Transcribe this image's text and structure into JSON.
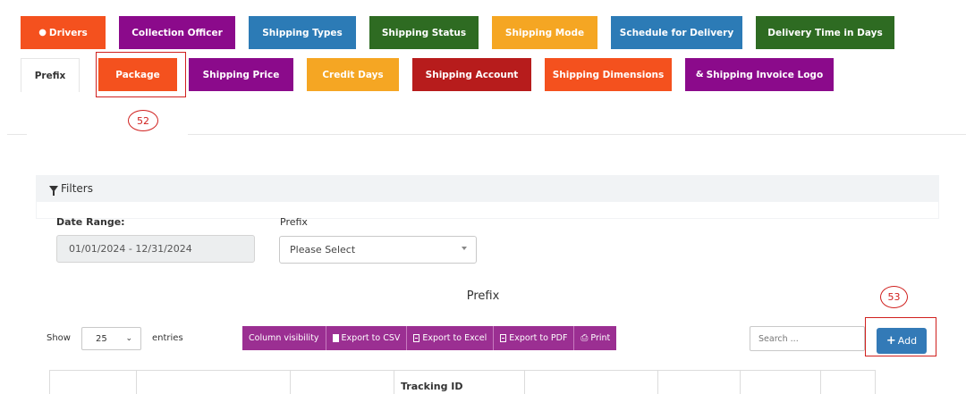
{
  "tabs_row1": [
    {
      "label": "Drivers",
      "color": "#f4511e",
      "icon": "user-icon"
    },
    {
      "label": "Collection Officer",
      "color": "#8b0a8b"
    },
    {
      "label": "Shipping Types",
      "color": "#2c7bb6"
    },
    {
      "label": "Shipping Status",
      "color": "#2e6b22"
    },
    {
      "label": "Shipping Mode",
      "color": "#f5a623"
    },
    {
      "label": "Schedule for Delivery",
      "color": "#2c7bb6"
    },
    {
      "label": "Delivery Time in Days",
      "color": "#2e6b22"
    }
  ],
  "tabs_row2": [
    {
      "label": "Prefix",
      "active": true
    },
    {
      "label": "Package",
      "color": "#f4511e"
    },
    {
      "label": "Shipping Price",
      "color": "#8b0a8b"
    },
    {
      "label": "Credit Days",
      "color": "#f5a623"
    },
    {
      "label": "Shipping Account",
      "color": "#b71c1c"
    },
    {
      "label": "Shipping Dimensions",
      "color": "#f4511e"
    },
    {
      "label": "Shipping Invoice Logo",
      "color": "#8b0a8b",
      "icon": "link-icon"
    }
  ],
  "callouts": {
    "package": "52",
    "add": "53"
  },
  "filters": {
    "title": "Filters",
    "date_range_label": "Date Range:",
    "date_range_value": "01/01/2024 - 12/31/2024",
    "prefix_label": "Prefix",
    "prefix_value": "Please Select"
  },
  "table": {
    "title": "Prefix",
    "show_label": "Show",
    "entries_value": "25",
    "entries_label": "entries",
    "buttons": [
      "Column visibility",
      "Export to CSV",
      "Export to Excel",
      "Export to PDF",
      "Print"
    ],
    "search_placeholder": "Search ...",
    "add_label": "Add",
    "columns": [
      "",
      "",
      "",
      "Tracking ID",
      "",
      "",
      "",
      ""
    ]
  },
  "colors": {
    "accent_red": "#d0201e",
    "button_purple": "#9b2f92",
    "add_blue": "#337ab7"
  }
}
